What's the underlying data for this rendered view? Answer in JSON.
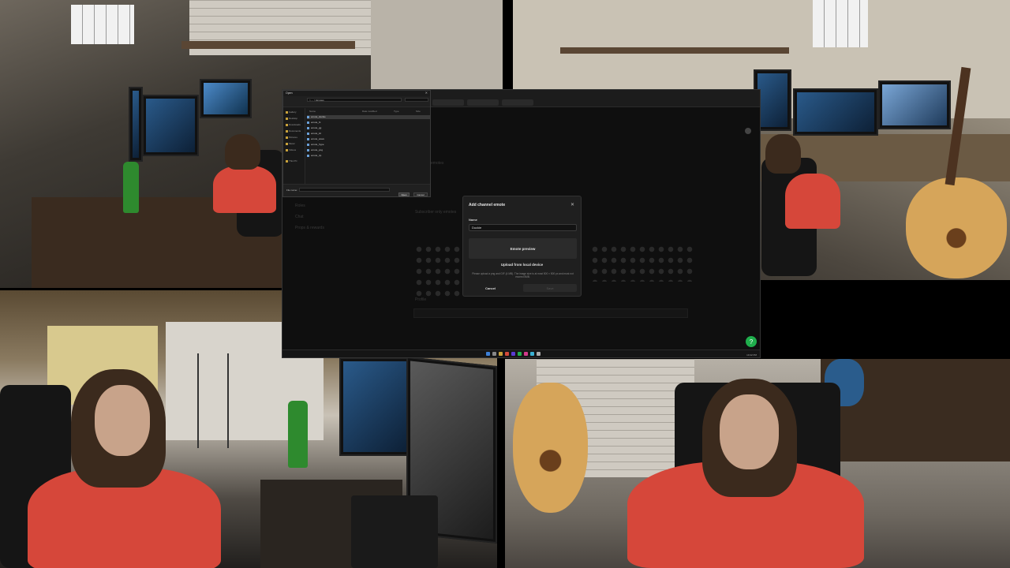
{
  "stream_layout": {
    "cameras": [
      "top-left",
      "top-right",
      "bottom-left",
      "bottom-right"
    ]
  },
  "modal": {
    "title": "Add channel emote",
    "close_icon": "close-icon",
    "name_label": "Name",
    "name_value": "Duckie",
    "preview_label": "Emote preview",
    "upload_label": "Upload from local device",
    "hint": "Please upload a png and GIF (4 MB). The image size is at most 500 × 500 px and must not exceed 5MB.",
    "cancel_label": "Cancel",
    "save_label": "Save"
  },
  "background_page": {
    "section_title": "emotes",
    "subscriber_title": "Subscriber only emotes",
    "profile_label": "Profile",
    "sidebar": [
      "Roles",
      "Chat",
      "Props & rewards"
    ]
  },
  "file_dialog": {
    "title": "Open",
    "close_icon": "close-icon",
    "address": "> ... > Emotes",
    "sidebar": [
      "Gallery",
      "Desktop",
      "Downloads",
      "Documents",
      "Pictures",
      "Music",
      "Videos",
      "This PC"
    ],
    "columns": [
      "Name",
      "Date modified",
      "Type",
      "Size"
    ],
    "rows": [
      {
        "name": "emote_duckie",
        "selected": true
      },
      {
        "name": "emote_hi",
        "selected": false
      },
      {
        "name": "emote_gg",
        "selected": false
      },
      {
        "name": "emote_lol",
        "selected": false
      },
      {
        "name": "emote_wave",
        "selected": false
      },
      {
        "name": "emote_hype",
        "selected": false
      },
      {
        "name": "emote_pog",
        "selected": false
      },
      {
        "name": "emote_rip",
        "selected": false
      }
    ],
    "file_name_label": "File name:",
    "open_label": "Open",
    "cancel_label": "Cancel"
  },
  "taskbar": {
    "clock": "10:42 PM"
  },
  "colors": {
    "accent_green": "#1fae4c",
    "shirt_red": "#d6473a",
    "folder_yellow": "#c9a23a"
  }
}
